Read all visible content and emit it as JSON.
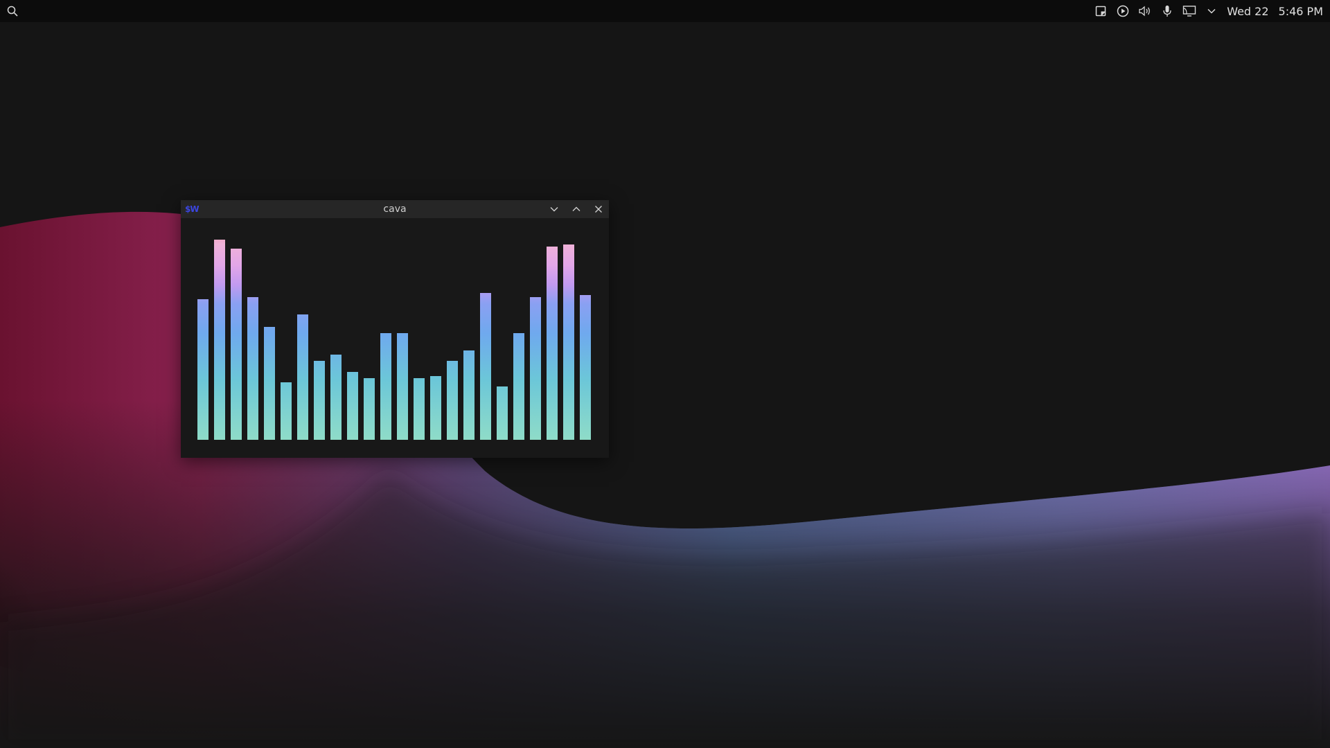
{
  "topbar": {
    "date": "Wed 22",
    "time": "5:46 PM",
    "icons": {
      "search": "search-icon",
      "notes": "note-icon",
      "media": "play-circle-icon",
      "volume": "volume-icon",
      "microphone": "microphone-icon",
      "display": "display-icon",
      "menu": "chevron-down-icon"
    }
  },
  "window": {
    "title": "cava",
    "app_icon_text": "$W",
    "buttons": {
      "minimize": "chevron-down-icon",
      "maximize": "chevron-up-icon",
      "close": "close-icon"
    }
  },
  "visualizer": {
    "levels": [
      0.66,
      0.94,
      0.9,
      0.67,
      0.53,
      0.27,
      0.59,
      0.37,
      0.4,
      0.32,
      0.29,
      0.5,
      0.5,
      0.29,
      0.3,
      0.37,
      0.42,
      0.69,
      0.25,
      0.5,
      0.67,
      0.91,
      0.92,
      0.68
    ],
    "gradient_colors": [
      "#8fdcc8",
      "#6cc7d8",
      "#6fa9ee",
      "#8aa0f2",
      "#c29af0",
      "#e2a6e8",
      "#f0b2d8",
      "#ee94a6"
    ]
  },
  "theme": {
    "desktop_bg": "#151515",
    "topbar_bg": "#0c0c0c",
    "window_bg": "#181818",
    "titlebar_bg": "#262626",
    "app_icon_color": "#3b46e0"
  }
}
